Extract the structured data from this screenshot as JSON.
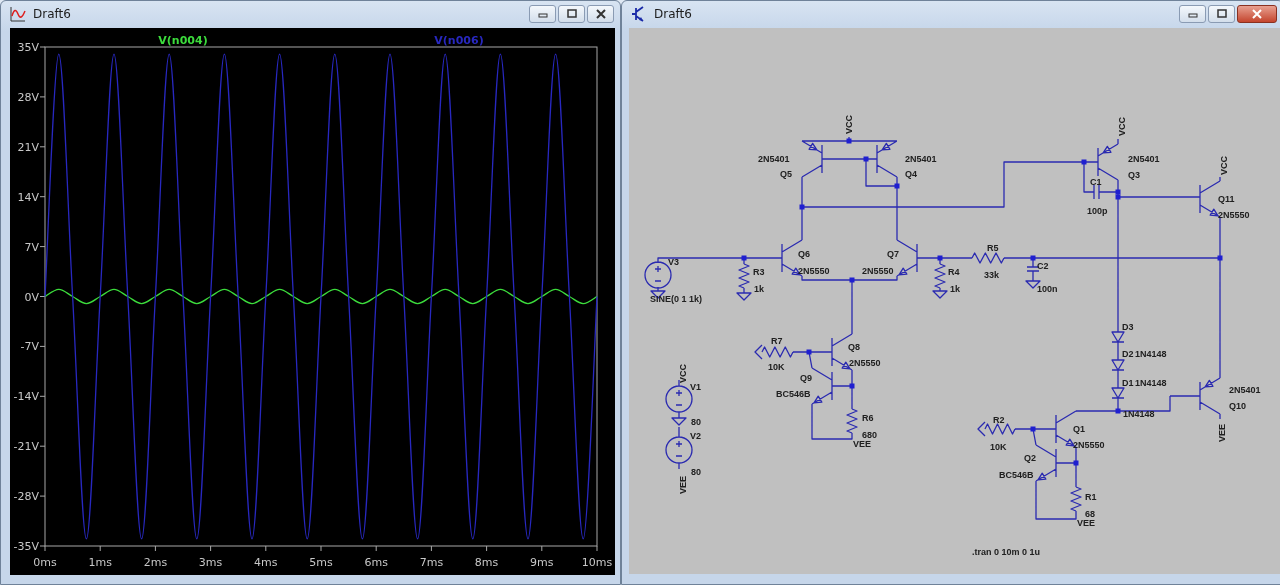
{
  "windows": [
    {
      "kind": "plot",
      "title": "Draft6",
      "chart_data": {
        "type": "line",
        "xlim": [
          0,
          10
        ],
        "ylim": [
          -35,
          35
        ],
        "xticks": [
          {
            "value": 0,
            "label": "0ms"
          },
          {
            "value": 1,
            "label": "1ms"
          },
          {
            "value": 2,
            "label": "2ms"
          },
          {
            "value": 3,
            "label": "3ms"
          },
          {
            "value": 4,
            "label": "4ms"
          },
          {
            "value": 5,
            "label": "5ms"
          },
          {
            "value": 6,
            "label": "6ms"
          },
          {
            "value": 7,
            "label": "7ms"
          },
          {
            "value": 8,
            "label": "8ms"
          },
          {
            "value": 9,
            "label": "9ms"
          },
          {
            "value": 10,
            "label": "10ms"
          }
        ],
        "yticks": [
          {
            "value": 35,
            "label": "35V"
          },
          {
            "value": 28,
            "label": "28V"
          },
          {
            "value": 21,
            "label": "21V"
          },
          {
            "value": 14,
            "label": "14V"
          },
          {
            "value": 7,
            "label": "7V"
          },
          {
            "value": 0,
            "label": "0V"
          },
          {
            "value": -7,
            "label": "-7V"
          },
          {
            "value": -14,
            "label": "-14V"
          },
          {
            "value": -21,
            "label": "-21V"
          },
          {
            "value": -28,
            "label": "-28V"
          },
          {
            "value": -35,
            "label": "-35V"
          }
        ],
        "x": [
          0,
          0.25,
          0.5,
          0.75,
          1,
          1.25,
          1.5,
          1.75,
          2,
          2.25,
          2.5,
          2.75,
          3,
          3.25,
          3.5,
          3.75,
          4,
          4.25,
          4.5,
          4.75,
          5,
          5.25,
          5.5,
          5.75,
          6,
          6.25,
          6.5,
          6.75,
          7,
          7.25,
          7.5,
          7.75,
          8,
          8.25,
          8.5,
          8.75,
          9,
          9.25,
          9.5,
          9.75,
          10
        ],
        "series": [
          {
            "name": "V(n004)",
            "color": "#3cdc3c",
            "values": [
              0,
              1,
              0,
              -1,
              0,
              1,
              0,
              -1,
              0,
              1,
              0,
              -1,
              0,
              1,
              0,
              -1,
              0,
              1,
              0,
              -1,
              0,
              1,
              0,
              -1,
              0,
              1,
              0,
              -1,
              0,
              1,
              0,
              -1,
              0,
              1,
              0,
              -1,
              0,
              1,
              0,
              -1,
              0
            ]
          },
          {
            "name": "V(n006)",
            "color": "#2828c0",
            "values": [
              0,
              34,
              0,
              -34,
              0,
              34,
              0,
              -34,
              0,
              34,
              0,
              -34,
              0,
              34,
              0,
              -34,
              0,
              34,
              0,
              -34,
              0,
              34,
              0,
              -34,
              0,
              34,
              0,
              -34,
              0,
              34,
              0,
              -34,
              0,
              34,
              0,
              -34,
              0,
              34,
              0,
              -34,
              0
            ]
          }
        ]
      }
    },
    {
      "kind": "schematic",
      "title": "Draft6",
      "labels": [
        "VCC",
        "2N5401",
        "Q5",
        "2N5401",
        "Q4",
        "Q6",
        "2N5550",
        "Q7",
        "2N5550",
        "V3",
        "R3",
        "1k",
        "SINE(0 1 1k)",
        "R4",
        "1k",
        "R5",
        "33k",
        "C2",
        "100n",
        "VCC",
        "2N5401",
        "Q3",
        "C1",
        "100p",
        "VCC",
        "Q11",
        "2N5550",
        "D3",
        "D2",
        "1N4148",
        "D1",
        "1N4148",
        "1N4148",
        "2N5401",
        "Q10",
        "VEE",
        "R7",
        "10K",
        "Q8",
        "2N5550",
        "Q9",
        "BC546B",
        "VCC",
        "V1",
        "80",
        "V2",
        "80",
        "VEE",
        "R6",
        "680",
        "VEE",
        "R2",
        "10K",
        "Q1",
        "2N5550",
        "Q2",
        "BC546B",
        "R1",
        "68",
        "VEE",
        ".tran 0 10m 0 1u"
      ]
    }
  ]
}
